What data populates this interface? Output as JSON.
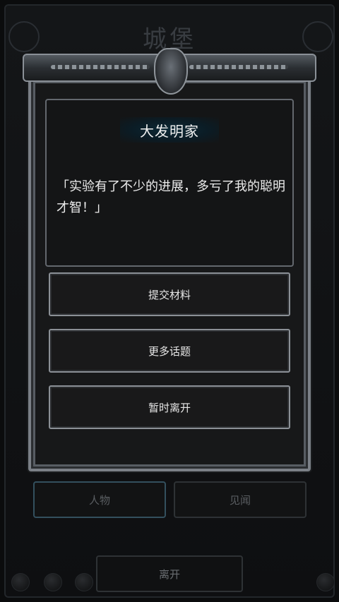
{
  "background": {
    "title": "城堡",
    "tabs": [
      {
        "label": "人物",
        "active": true
      },
      {
        "label": "见闻",
        "active": false
      }
    ],
    "leave_label": "离开"
  },
  "dialog": {
    "npc_name": "大发明家",
    "message": "「实验有了不少的进展，多亏了我的聪明才智！」",
    "choices": [
      {
        "label": "提交材料"
      },
      {
        "label": "更多话题"
      },
      {
        "label": "暂时离开"
      }
    ]
  },
  "colors": {
    "frame": "#7b8087",
    "name_glow": "#0d2a37",
    "panel_bg": "#171819"
  }
}
